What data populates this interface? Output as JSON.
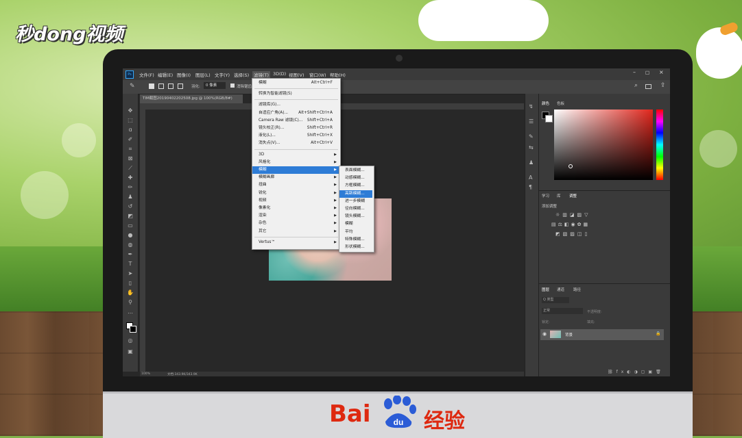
{
  "watermark": {
    "top_left": "秒dong视频",
    "baidu_text": "Bai",
    "baidu_du": "du",
    "baidu_suffix": "经验"
  },
  "ps": {
    "app_icon": "Ps",
    "menubar": [
      "文件(F)",
      "编辑(E)",
      "图像(I)",
      "图层(L)",
      "文字(Y)",
      "选择(S)",
      "滤镜(T)",
      "3D(D)",
      "视图(V)",
      "窗口(W)",
      "帮助(H)"
    ],
    "window_controls": [
      "–",
      "□",
      "×"
    ],
    "options": {
      "feather_label": "羽化:",
      "feather_value": "0 像素",
      "antialias_label": "消除锯齿"
    },
    "doc_tab": "TIM截图20190402202508.jpg @ 100%(RGB/8#)",
    "status": {
      "zoom": "100%",
      "doc_info": "文档:343.9K/343.9K"
    },
    "filter_menu": [
      {
        "label": "模糊",
        "shortcut": "Alt+Ctrl+F"
      },
      {
        "sep": true
      },
      {
        "label": "转换为智能滤镜(S)",
        "shortcut": ""
      },
      {
        "sep": true
      },
      {
        "label": "滤镜库(G)...",
        "shortcut": ""
      },
      {
        "label": "自适应广角(A)...",
        "shortcut": "Alt+Shift+Ctrl+A"
      },
      {
        "label": "Camera Raw 滤镜(C)...",
        "shortcut": "Shift+Ctrl+A"
      },
      {
        "label": "镜头校正(R)...",
        "shortcut": "Shift+Ctrl+R"
      },
      {
        "label": "液化(L)...",
        "shortcut": "Shift+Ctrl+X"
      },
      {
        "label": "消失点(V)...",
        "shortcut": "Alt+Ctrl+V"
      },
      {
        "sep": true
      },
      {
        "label": "3D",
        "sub": true
      },
      {
        "label": "风格化",
        "sub": true
      },
      {
        "label": "模糊",
        "sub": true,
        "selected": true
      },
      {
        "label": "模糊画廊",
        "sub": true
      },
      {
        "label": "扭曲",
        "sub": true
      },
      {
        "label": "锐化",
        "sub": true
      },
      {
        "label": "视频",
        "sub": true
      },
      {
        "label": "像素化",
        "sub": true
      },
      {
        "label": "渲染",
        "sub": true
      },
      {
        "label": "杂色",
        "sub": true
      },
      {
        "label": "其它",
        "sub": true
      },
      {
        "sep": true
      },
      {
        "label": "Vertus™",
        "sub": true
      }
    ],
    "blur_submenu": [
      {
        "label": "表面模糊..."
      },
      {
        "label": "动感模糊..."
      },
      {
        "label": "方框模糊..."
      },
      {
        "label": "高斯模糊...",
        "selected": true
      },
      {
        "label": "进一步模糊"
      },
      {
        "label": "径向模糊..."
      },
      {
        "label": "镜头模糊..."
      },
      {
        "label": "模糊"
      },
      {
        "label": "平均"
      },
      {
        "label": "特殊模糊..."
      },
      {
        "label": "形状模糊..."
      }
    ],
    "panels": {
      "color_tabs": [
        "颜色",
        "色板"
      ],
      "adjust_tabs": [
        "学习",
        "库",
        "调整"
      ],
      "add_adjust": "添加调整",
      "layer_tabs": [
        "图层",
        "通道",
        "路径"
      ],
      "layer_kind": "Q 类型",
      "blend_mode": "正常",
      "opacity_label": "不透明度:",
      "lock_label": "锁定:",
      "fill_label": "填充:",
      "layer_name": "背景"
    },
    "colors": {
      "accent": "#2e7cd6",
      "bg": "#282828"
    }
  }
}
